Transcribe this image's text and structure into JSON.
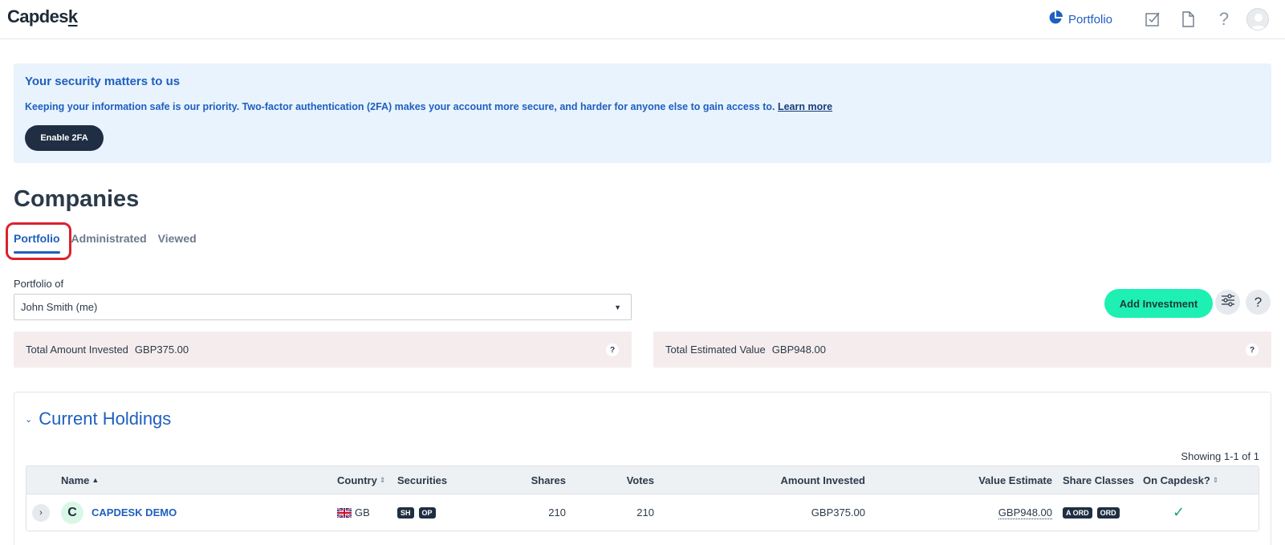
{
  "app": {
    "logo": "Capdes",
    "logo_last": "k"
  },
  "header": {
    "nav_portfolio": "Portfolio",
    "icons": [
      "pie-chart-icon",
      "tasks-checkbox-icon",
      "document-icon",
      "help-icon",
      "avatar"
    ]
  },
  "banner": {
    "title": "Your security matters to us",
    "text": "Keeping your information safe is our priority. Two-factor authentication (2FA) makes your account more secure, and harder for anyone else to gain access to.",
    "link": "Learn more",
    "button": "Enable 2FA"
  },
  "page": {
    "title": "Companies",
    "tabs": [
      {
        "label": "Portfolio",
        "active": true
      },
      {
        "label": "Administrated",
        "active": false
      },
      {
        "label": "Viewed",
        "active": false
      }
    ]
  },
  "filters": {
    "portfolio_of_label": "Portfolio of",
    "portfolio_of_value": "John Smith (me)",
    "add_investment": "Add Investment",
    "help": "?"
  },
  "summary": {
    "invested_label": "Total Amount Invested",
    "invested_value": "GBP375.00",
    "estimated_label": "Total Estimated Value",
    "estimated_value": "GBP948.00",
    "help": "?"
  },
  "holdings": {
    "title": "Current Holdings",
    "showing": "Showing 1-1 of 1",
    "columns": {
      "name": "Name",
      "country": "Country",
      "securities": "Securities",
      "shares": "Shares",
      "votes": "Votes",
      "amount_invested": "Amount Invested",
      "value_estimate": "Value Estimate",
      "share_classes": "Share Classes",
      "on_capdesk": "On Capdesk?"
    },
    "rows": [
      {
        "logo_letter": "C",
        "name": "CAPDESK DEMO",
        "country": "GB",
        "securities": [
          "SH",
          "OP"
        ],
        "shares": "210",
        "votes": "210",
        "amount_invested": "GBP375.00",
        "value_estimate": "GBP948.00",
        "share_classes": [
          "A ORD",
          "ORD"
        ],
        "on_capdesk": "✓"
      }
    ]
  },
  "colors": {
    "brand_blue": "#1f5fbf",
    "accent_green": "#1ef0b4",
    "dark": "#1f2e42",
    "highlight_red": "#d9232e"
  }
}
